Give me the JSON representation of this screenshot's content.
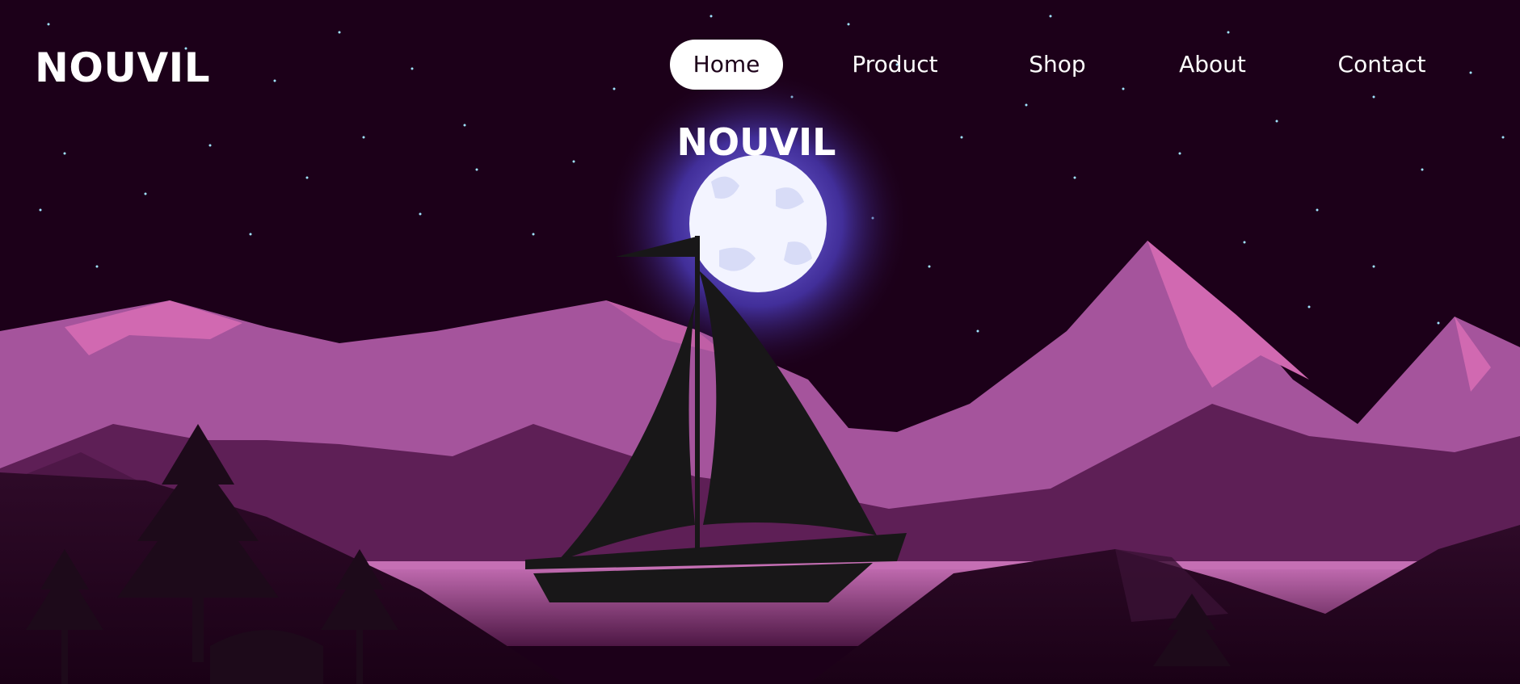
{
  "brand": {
    "name": "NOUVIL"
  },
  "nav": {
    "items": [
      {
        "label": "Home",
        "active": true
      },
      {
        "label": "Product",
        "active": false
      },
      {
        "label": "Shop",
        "active": false
      },
      {
        "label": "About",
        "active": false
      },
      {
        "label": "Contact",
        "active": false
      }
    ]
  },
  "hero": {
    "title": "NOUVIL"
  },
  "colors": {
    "sky": "#1c0019",
    "mountain_far": "#a5549c",
    "mountain_peak": "#d169b1",
    "mountain_mid": "#5e1f56",
    "lake": "#b966ab",
    "foreground": "#26061f",
    "moon": "#f3f4ff",
    "moon_glow": "#7c6cf0",
    "silhouette": "#181718"
  },
  "icons": [
    "moon-icon",
    "sailboat-icon",
    "pine-tree-icon"
  ]
}
